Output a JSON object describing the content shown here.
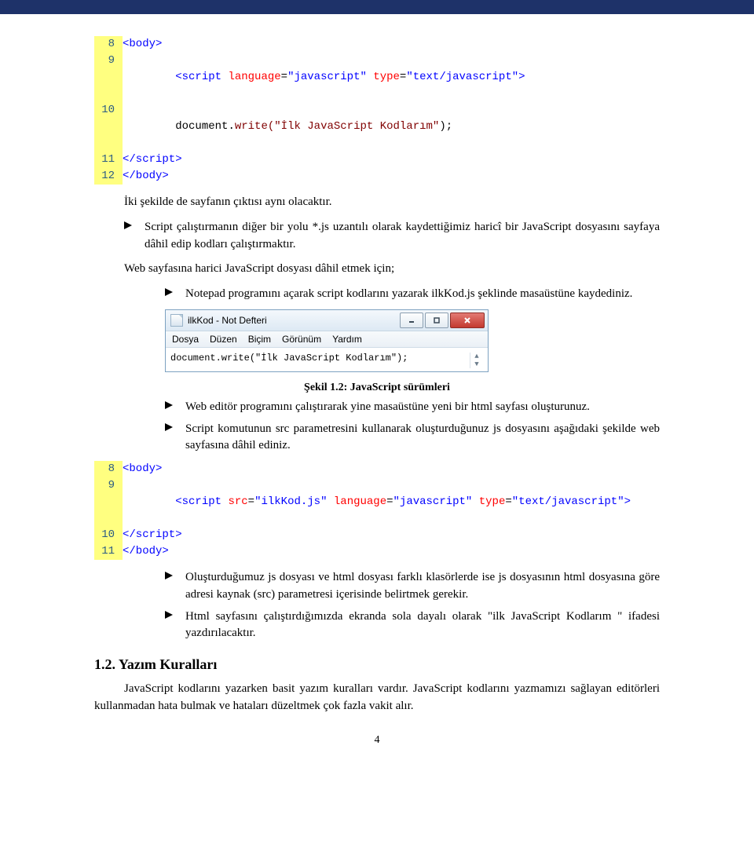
{
  "code1": {
    "lines": [
      "8",
      "9",
      "10",
      "11",
      "12"
    ],
    "l1_tag": "<body>",
    "l2_open": "<script ",
    "l2_attr1": "language",
    "l2_eq": "=",
    "l2_v1": "\"javascript\"",
    "l2_attr2": "type",
    "l2_v2": "\"text/javascript\"",
    "l2_close": ">",
    "l3_obj": "document",
    "l3_dot": ".",
    "l3_fn": "write(",
    "l3_str": "\"İlk JavaScript Kodlarım\"",
    "l3_end": ");",
    "l4_tag": "</script>",
    "l5_tag": "</body>"
  },
  "p1": "İki şekilde de sayfanın çıktısı aynı olacaktır.",
  "b1": "Script çalıştırmanın diğer bir yolu *.js uzantılı olarak kaydettiğimiz haricî bir JavaScript dosyasını sayfaya dâhil edip kodları çalıştırmaktır.",
  "p2": "Web sayfasına harici JavaScript dosyası dâhil etmek için;",
  "b2": "Notepad programını açarak script kodlarını yazarak ilkKod.js şeklinde masaüstüne kaydediniz.",
  "notepad": {
    "title": "ilkKod - Not Defteri",
    "menu": [
      "Dosya",
      "Düzen",
      "Biçim",
      "Görünüm",
      "Yardım"
    ],
    "body": "document.write(\"İlk JavaScript Kodlarım\");"
  },
  "caption": "Şekil 1.2: JavaScript sürümleri",
  "b3": "Web editör programını çalıştırarak yine masaüstüne yeni bir html sayfası oluşturunuz.",
  "b4": "Script komutunun src parametresini kullanarak oluşturduğunuz js dosyasını aşağıdaki şekilde web sayfasına dâhil ediniz.",
  "code2": {
    "lines": [
      "8",
      "9",
      "10",
      "11"
    ],
    "l1_tag": "<body>",
    "l2_open": "<script ",
    "l2_a1": "src",
    "l2_v1": "\"ilkKod.js\"",
    "l2_a2": "language",
    "l2_v2": "\"javascript\"",
    "l2_a3": "type",
    "l2_v3": "\"text/javascript\"",
    "l2_close": ">",
    "l3_tag": "</script>",
    "l4_tag": "</body>"
  },
  "b5": "Oluşturduğumuz js dosyası ve html dosyası farklı klasörlerde ise js dosyasının html dosyasına göre adresi kaynak (src) parametresi içerisinde belirtmek gerekir.",
  "b6": "Html sayfasını çalıştırdığımızda ekranda sola dayalı olarak \"ilk JavaScript Kodlarım \" ifadesi yazdırılacaktır.",
  "heading": "1.2. Yazım Kuralları",
  "p3": "JavaScript kodlarını yazarken basit yazım kuralları vardır. JavaScript kodlarını yazmamızı sağlayan editörleri kullanmadan hata bulmak ve hataları düzeltmek çok fazla vakit alır.",
  "pageNum": "4"
}
